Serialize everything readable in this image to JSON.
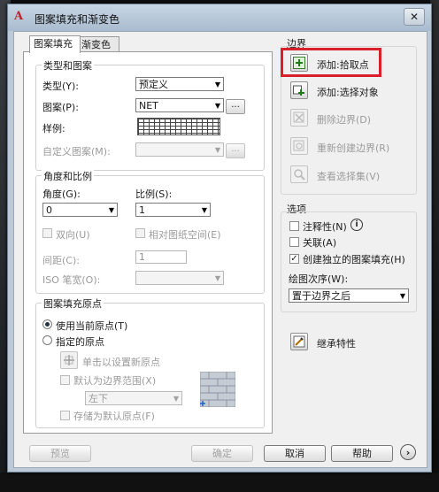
{
  "window": {
    "title": "图案填充和渐变色",
    "app_icon_text": "A"
  },
  "tabs": [
    {
      "label": "图案填充",
      "active": true
    },
    {
      "label": "渐变色",
      "active": false
    }
  ],
  "type_pattern": {
    "title": "类型和图案",
    "type_label": "类型(Y):",
    "type_value": "预定义",
    "pattern_label": "图案(P):",
    "pattern_value": "NET",
    "browse_label": "...",
    "sample_label": "样例:",
    "custom_label": "自定义图案(M):",
    "custom_browse_label": "..."
  },
  "angle_scale": {
    "title": "角度和比例",
    "angle_label": "角度(G):",
    "angle_value": "0",
    "scale_label": "比例(S):",
    "scale_value": "1",
    "double_label": "双向(U)",
    "relative_label": "相对图纸空间(E)",
    "spacing_label": "间距(C):",
    "spacing_value": "1",
    "iso_label": "ISO 笔宽(O):"
  },
  "origin": {
    "title": "图案填充原点",
    "use_current": "使用当前原点(T)",
    "specified": "指定的原点",
    "click_set": "单击以设置新原点",
    "default_boundary": "默认为边界范围(X)",
    "position_value": "左下",
    "store_default": "存储为默认原点(F)"
  },
  "boundaries": {
    "title": "边界",
    "add_pick": "添加:拾取点",
    "add_select": "添加:选择对象",
    "remove": "删除边界(D)",
    "recreate": "重新创建边界(R)",
    "view_selection": "查看选择集(V)"
  },
  "options": {
    "title": "选项",
    "annotative": "注释性(N)",
    "annotative_info": "i",
    "associative": "关联(A)",
    "associative_checked": false,
    "separate": "创建独立的图案填充(H)",
    "separate_checked": true,
    "draw_order_label": "绘图次序(W):",
    "draw_order_value": "置于边界之后"
  },
  "inherit_label": "继承特性",
  "buttons": {
    "preview": "预览",
    "ok": "确定",
    "cancel": "取消",
    "help": "帮助",
    "more": "›"
  },
  "colors": {
    "highlight": "#d81f2a",
    "title_bar": "#b7c8da",
    "dialog_bg": "#f0f0f0"
  }
}
